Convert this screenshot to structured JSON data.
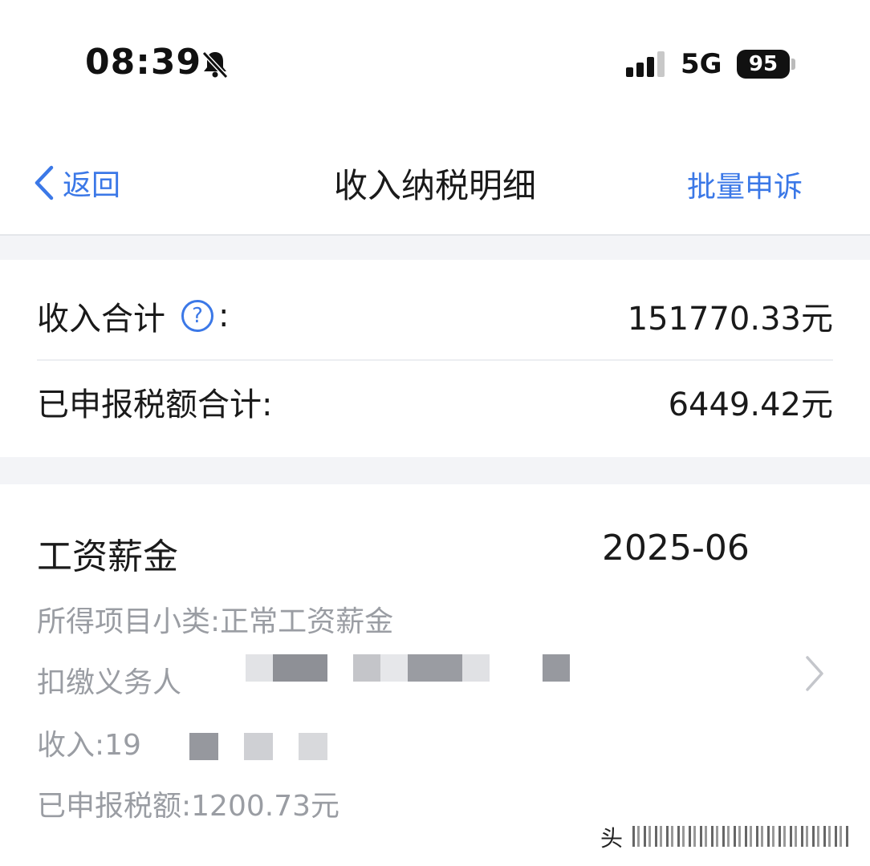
{
  "status_bar": {
    "time": "08:39",
    "network": "5G",
    "battery": "95",
    "icons": [
      "bell-off-icon",
      "signal-icon"
    ]
  },
  "nav": {
    "back_label": "返回",
    "title": "收入纳税明细",
    "action_label": "批量申诉",
    "accent_color": "#3b78e7"
  },
  "summary": {
    "income_total_label": "收入合计",
    "income_total_colon": ":",
    "income_total_value": "151770.33元",
    "tax_total_label": "已申报税额合计:",
    "tax_total_value": "6449.42元"
  },
  "record": {
    "type": "工资薪金",
    "date": "2025-06",
    "subcategory_line": "所得项目小类:正常工资薪金",
    "withholder_label": "扣缴义务人",
    "income_line": "收入:19",
    "tax_line": "已申报税额:1200.73元"
  },
  "watermark": {
    "text": "头"
  }
}
